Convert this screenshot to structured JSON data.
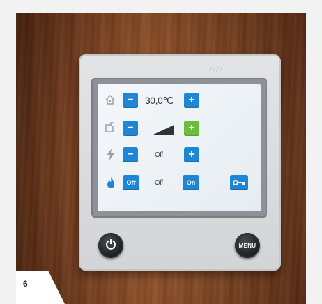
{
  "controller": {
    "brand_text": "////",
    "rows": [
      {
        "icon": "house-icon",
        "minus": "−",
        "value": "30,0℃",
        "plus": "+"
      },
      {
        "icon": "water-tap-icon",
        "minus": "−",
        "level": 0.6,
        "plus": "+"
      },
      {
        "icon": "lightning-icon",
        "minus": "−",
        "value": "Off",
        "plus": "+"
      },
      {
        "icon": "flame-icon",
        "off_label": "Off",
        "value": "Off",
        "on_label": "On"
      }
    ],
    "key_icon": "key-icon",
    "power_icon": "power-icon",
    "menu_label": "MENU"
  },
  "caption": {
    "page_number": "6"
  },
  "colors": {
    "button_blue": "#1f86d6",
    "button_green": "#6bbd3d",
    "panel": "#dcdee1",
    "wood": "#8a4520"
  }
}
